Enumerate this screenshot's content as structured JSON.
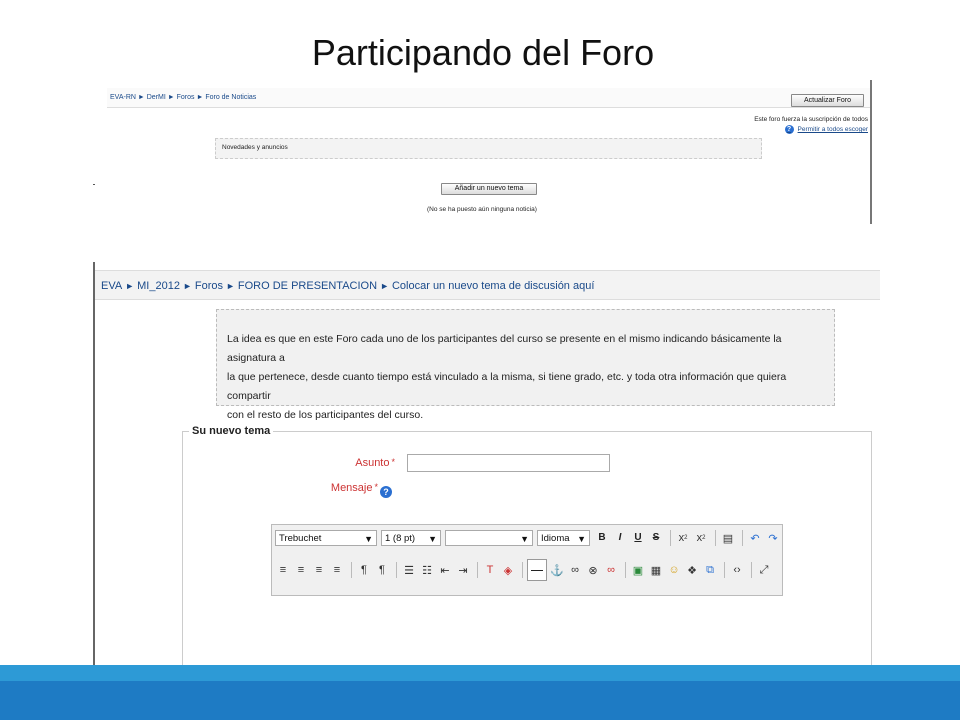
{
  "slide": {
    "title": "Participando del Foro"
  },
  "shot1": {
    "breadcrumb": "EVA-RN ► DerMI ► Foros ► Foro de Noticias",
    "update_button": "Actualizar Foro",
    "subscription_text": "Este foro fuerza la suscripción de todos",
    "allow_link": "Permitir a todos escoger",
    "section_label": "Novedades y anuncios",
    "add_topic_button": "Añadir un nuevo tema",
    "empty_text": "(No se ha puesto aún ninguna noticia)"
  },
  "shot2": {
    "breadcrumb": [
      "EVA",
      "MI_2012",
      "Foros",
      "FORO DE PRESENTACION",
      "Colocar un nuevo tema de discusión aquí"
    ],
    "intro_lines": [
      "La idea es que en este Foro cada uno de los participantes del curso se presente en el mismo indicando básicamente la asignatura a",
      "la que pertenece, desde cuanto tiempo está vinculado a la misma, si tiene grado, etc. y toda otra información que quiera compartir",
      "con el resto de los participantes del curso."
    ],
    "legend": "Su nuevo tema",
    "subject_label": "Asunto",
    "message_label": "Mensaje",
    "required_mark": "*",
    "toolbar": {
      "font": "Trebuchet",
      "size": "1 (8 pt)",
      "style": "",
      "language": "Idioma",
      "bold": "B",
      "italic": "I",
      "underline": "U",
      "strike": "S"
    }
  },
  "colors": {
    "accent": "#1e7bc4",
    "link": "#1a4a8a",
    "required": "#cc3333"
  }
}
